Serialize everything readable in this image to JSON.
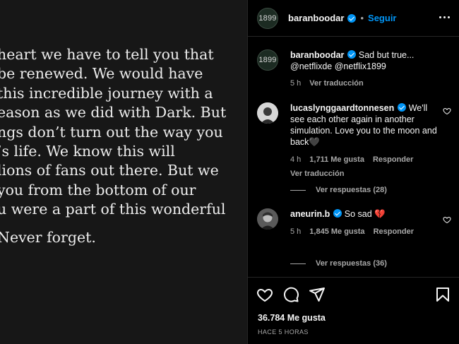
{
  "post": {
    "lines": [
      "heart we have to tell you that",
      "be renewed. We would have",
      " this incredible journey with a",
      "eason as we did with Dark. But",
      "ngs don’t turn out the way you",
      "’s life. We know this will",
      "lions of fans out there. But we",
      " you from the bottom of our",
      "u were a part of this wonderful",
      "Never forget."
    ]
  },
  "header": {
    "avatar_text": "1899",
    "username": "baranboodar",
    "separator": "•",
    "follow_label": "Seguir",
    "more_icon": "more-horizontal-icon"
  },
  "caption": {
    "avatar_text": "1899",
    "username": "baranboodar",
    "text": " Sad but true... @netflixde @netflix1899",
    "time": "5 h",
    "translate": "Ver traducción"
  },
  "comments": [
    {
      "username": "lucaslynggaardtonnesen",
      "text": " We'll see each other again in another simulation. Love you to the moon and back🖤",
      "time": "4 h",
      "likes": "1,711 Me gusta",
      "reply": "Responder",
      "translate": "Ver traducción",
      "replies": "Ver respuestas (28)"
    },
    {
      "username": "aneurin.b",
      "text": " So sad 💔",
      "time": "5 h",
      "likes": "1,845 Me gusta",
      "reply": "Responder",
      "replies": "Ver respuestas (36)"
    }
  ],
  "actions": {
    "likes": "36.784 Me gusta",
    "when": "HACE 5 HORAS"
  },
  "colors": {
    "accent": "#0095f6",
    "background": "#000000",
    "muted": "#a8a8a8"
  }
}
